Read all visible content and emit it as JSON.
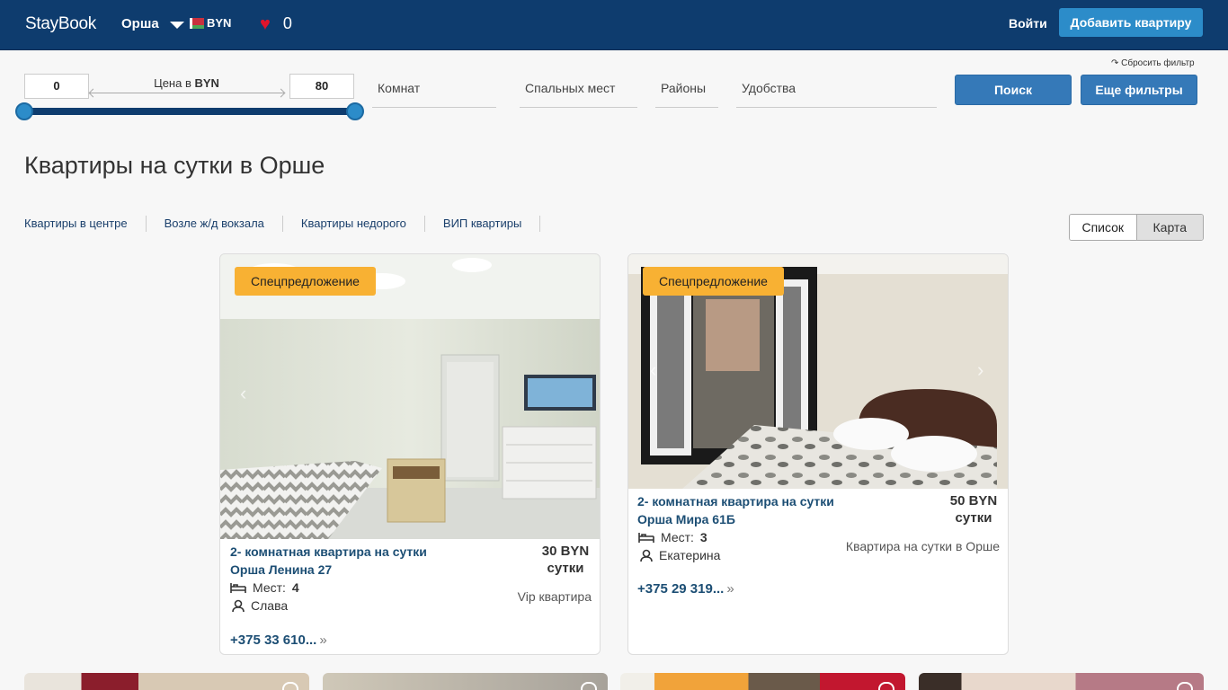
{
  "header": {
    "logo": "StayBook",
    "city": "Орша",
    "currency": "BYN",
    "favorites_count": "0",
    "login": "Войти",
    "add_apartment": "Добавить квартиру"
  },
  "filters": {
    "reset": "↷ Сбросить фильтр",
    "price_min": "0",
    "price_max": "80",
    "price_label_prefix": "Цена в ",
    "price_label_currency": "BYN",
    "slider_min_fraction": 0,
    "slider_max_fraction": 1,
    "rooms": "Комнат",
    "beds": "Спальных мест",
    "districts": "Районы",
    "amenities": "Удобства",
    "search": "Поиск",
    "more_filters": "Еще фильтры"
  },
  "page_title": "Квартиры на сутки в Орше",
  "quicklinks": [
    "Квартиры в центре",
    "Возле ж/д вокзала",
    "Квартиры недорого",
    "ВИП квартиры"
  ],
  "view": {
    "list": "Список",
    "map": "Карта",
    "selected": "Список"
  },
  "listings": [
    {
      "badge": "Спецпредложение",
      "title_line1": "2- комнатная квартира на сутки",
      "title_line2": "Орша Ленина 27",
      "price": "30 BYN",
      "price_unit": "сутки",
      "places_label": "Мест:",
      "places": "4",
      "host": "Слава",
      "type": "Vip квартира",
      "phone": "+375 33 610..."
    },
    {
      "badge": "Спецпредложение",
      "title_line1": "2- комнатная квартира на сутки",
      "title_line2": "Орша Мира 61Б",
      "price": "50 BYN",
      "price_unit": "сутки",
      "places_label": "Мест:",
      "places": "3",
      "host": "Екатерина",
      "type": "Квартира на сутки в Орше",
      "phone": "+375 29 319..."
    }
  ],
  "colors": {
    "header_bg": "#0e3c6e",
    "accent": "#2c8cc9",
    "button": "#3579b8",
    "badge": "#f8b133",
    "heart": "#e0142b",
    "link": "#1c4e74"
  }
}
